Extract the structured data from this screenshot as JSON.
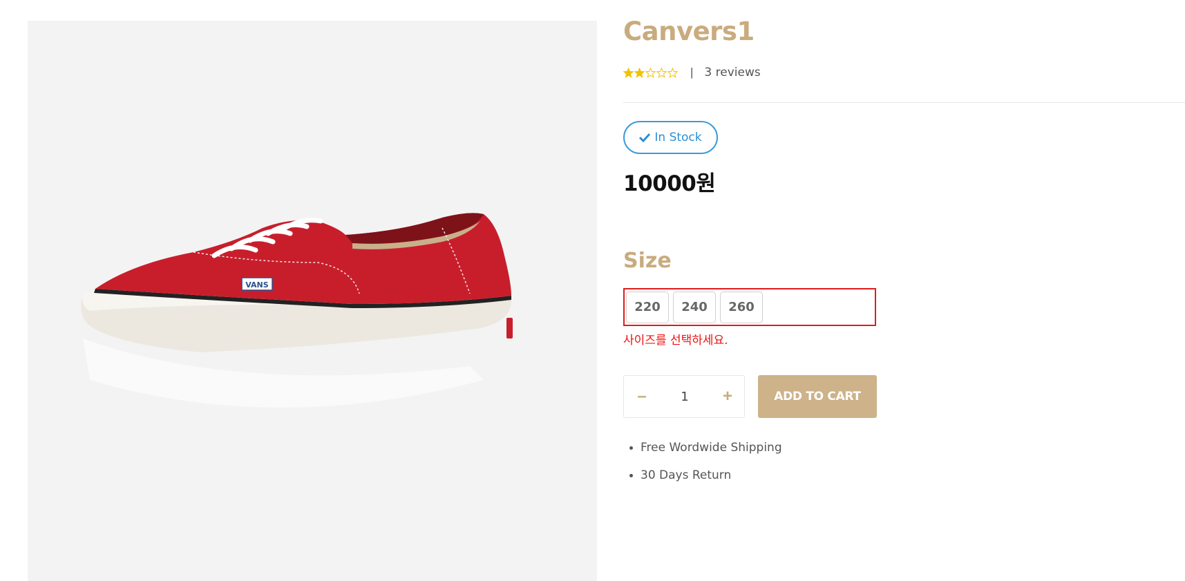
{
  "product": {
    "title": "Canvers1",
    "rating": 2,
    "rating_max": 5,
    "rating_separator": "|",
    "reviews_text": "3 reviews",
    "stock_label": "In Stock",
    "price": "10000원",
    "size_heading": "Size",
    "sizes": [
      "220",
      "240",
      "260"
    ],
    "size_error": "사이즈를 선택하세요.",
    "quantity": "1",
    "add_to_cart_label": "ADD TO CART",
    "features": [
      "Free Wordwide Shipping",
      "30 Days Return"
    ]
  },
  "icons": {
    "star_filled": "star-filled-icon",
    "star_empty": "star-empty-icon",
    "check": "check-icon",
    "minus": "minus-icon",
    "plus": "plus-icon"
  },
  "colors": {
    "accent": "#c9ab7e",
    "button": "#cdb28a",
    "stock": "#2b8fd6",
    "error": "#ee1111",
    "star": "#f2c200"
  }
}
